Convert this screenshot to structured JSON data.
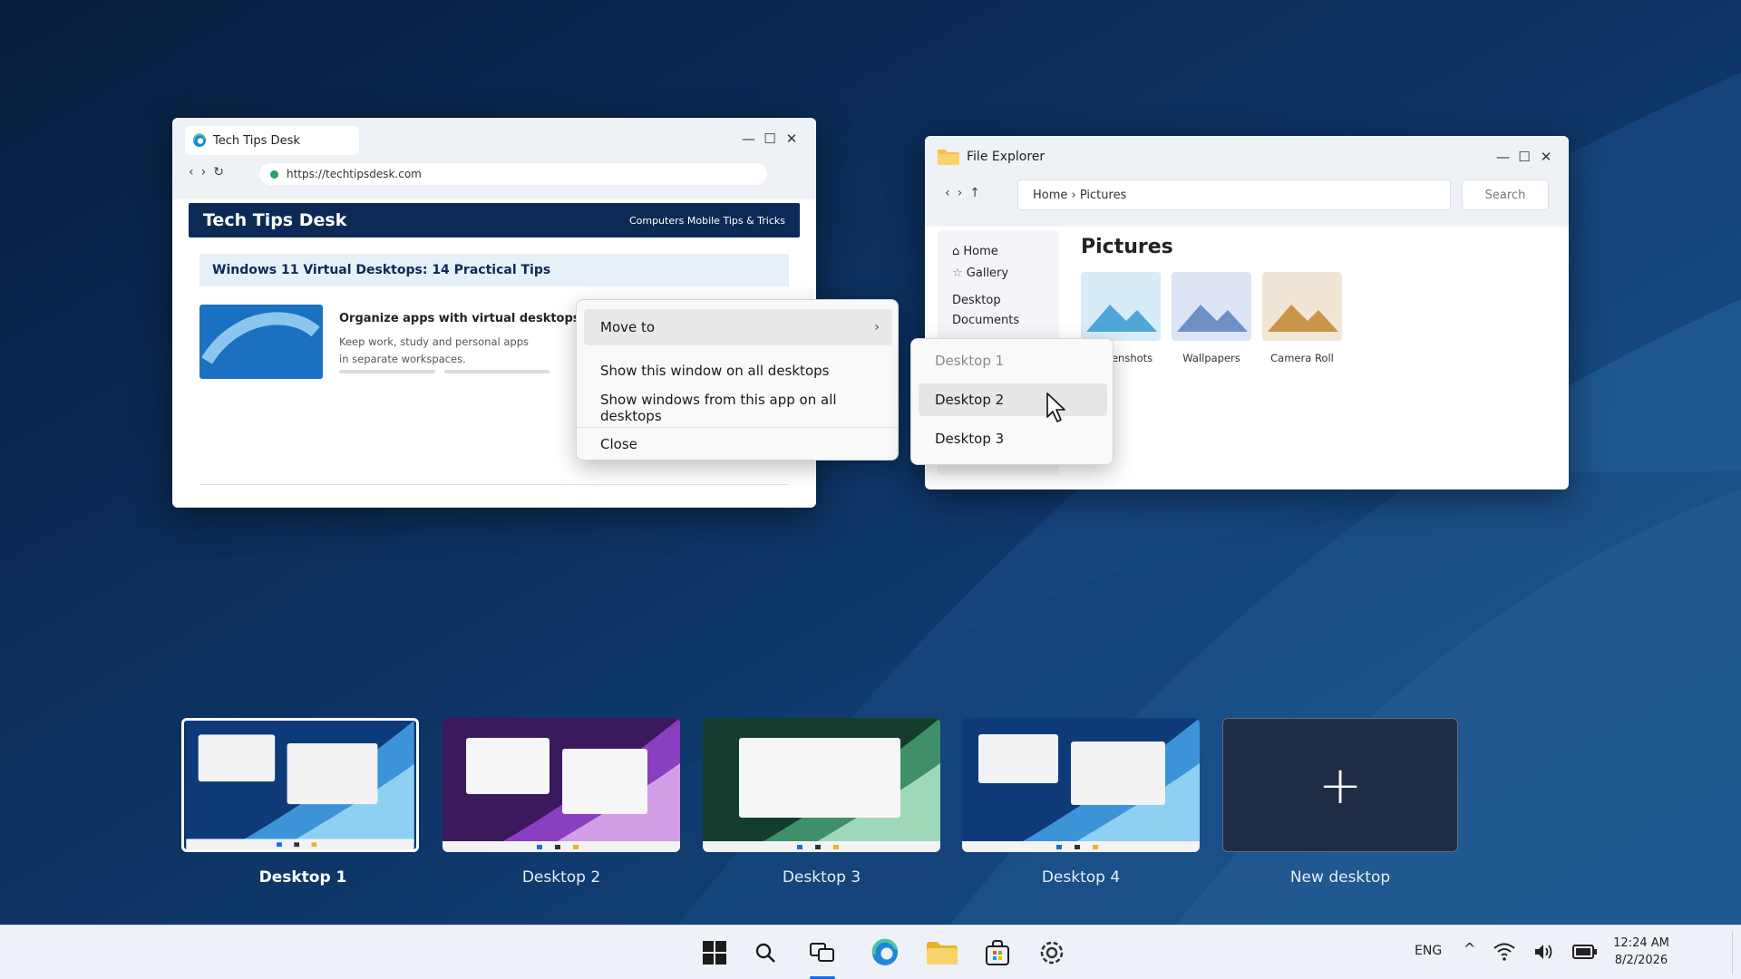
{
  "browser": {
    "tab_title": "Tech Tips Desk",
    "url": "https://techtipsdesk.com",
    "site_title": "Tech Tips Desk",
    "site_nav": "Computers Mobile Tips & Tricks",
    "article_title": "Windows 11 Virtual Desktops: 14 Practical Tips",
    "card_heading": "Organize apps with virtual desktops",
    "card_body_line1": "Keep work, study and personal apps",
    "card_body_line2": "in separate workspaces."
  },
  "explorer": {
    "title": "File Explorer",
    "path": "Home › Pictures",
    "search_placeholder": "Search",
    "sidebar": [
      "Home",
      "Gallery",
      "Desktop",
      "Documents"
    ],
    "heading": "Pictures",
    "folders": [
      "Screenshots",
      "Wallpapers",
      "Camera Roll"
    ]
  },
  "context_menu": {
    "items": [
      "Move to",
      "Show this window on all desktops",
      "Show windows from this app on all desktops",
      "Close"
    ],
    "submenu": [
      "Desktop 1",
      "Desktop 2",
      "Desktop 3"
    ]
  },
  "desktops": {
    "items": [
      "Desktop 1",
      "Desktop 2",
      "Desktop 3",
      "Desktop 4"
    ],
    "new_label": "New desktop",
    "active": "Desktop 1"
  },
  "taskbar": {
    "language": "ENG",
    "time": "12:24 AM",
    "date": "8/2/2026",
    "icons": [
      "start-icon",
      "search-icon",
      "task-view-icon",
      "edge-icon",
      "file-explorer-icon",
      "store-icon",
      "settings-icon"
    ]
  },
  "colors": {
    "accent": "#1a6ce0",
    "wallpaper": "#0b2c57"
  }
}
